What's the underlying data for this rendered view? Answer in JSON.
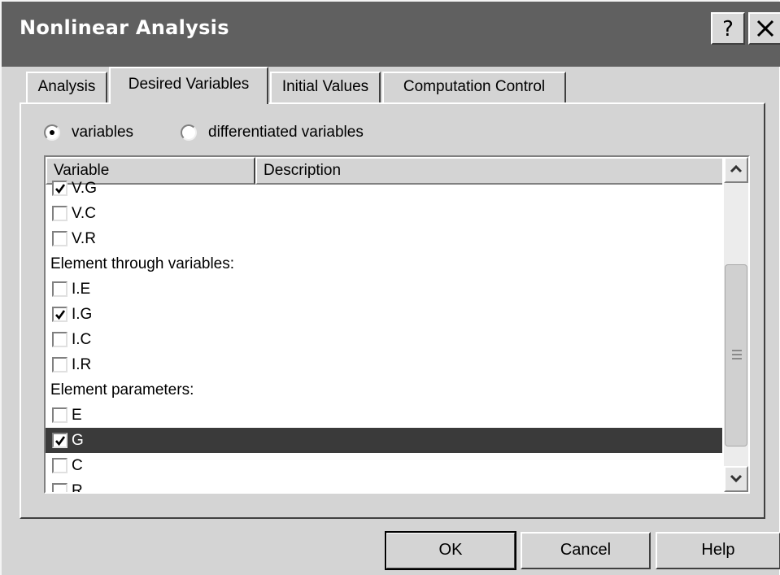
{
  "window": {
    "title": "Nonlinear Analysis",
    "help_button": "?",
    "close_button": "X"
  },
  "tabs": [
    {
      "label": "Analysis",
      "active": false
    },
    {
      "label": "Desired Variables",
      "active": true
    },
    {
      "label": "Initial Values",
      "active": false
    },
    {
      "label": "Computation Control",
      "active": false
    }
  ],
  "mode": {
    "options": [
      {
        "label": "variables",
        "selected": true
      },
      {
        "label": "differentiated variables",
        "selected": false
      }
    ]
  },
  "list": {
    "columns": [
      "Variable",
      "Description"
    ],
    "rows": [
      {
        "type": "item",
        "label": "V.G",
        "checked": true
      },
      {
        "type": "item",
        "label": "V.C",
        "checked": false
      },
      {
        "type": "item",
        "label": "V.R",
        "checked": false
      },
      {
        "type": "group",
        "label": "Element through variables:"
      },
      {
        "type": "item",
        "label": "I.E",
        "checked": false
      },
      {
        "type": "item",
        "label": "I.G",
        "checked": true
      },
      {
        "type": "item",
        "label": "I.C",
        "checked": false
      },
      {
        "type": "item",
        "label": "I.R",
        "checked": false
      },
      {
        "type": "group",
        "label": "Element parameters:"
      },
      {
        "type": "item",
        "label": "E",
        "checked": false
      },
      {
        "type": "item",
        "label": "G",
        "checked": true,
        "selected": true
      },
      {
        "type": "item",
        "label": "C",
        "checked": false
      },
      {
        "type": "item",
        "label": "R",
        "checked": false
      }
    ]
  },
  "buttons": {
    "ok": "OK",
    "cancel": "Cancel",
    "help": "Help"
  },
  "colors": {
    "titlebar": "#606060",
    "dialog_face": "#d4d4d4",
    "selection": "#3a3a3a"
  }
}
